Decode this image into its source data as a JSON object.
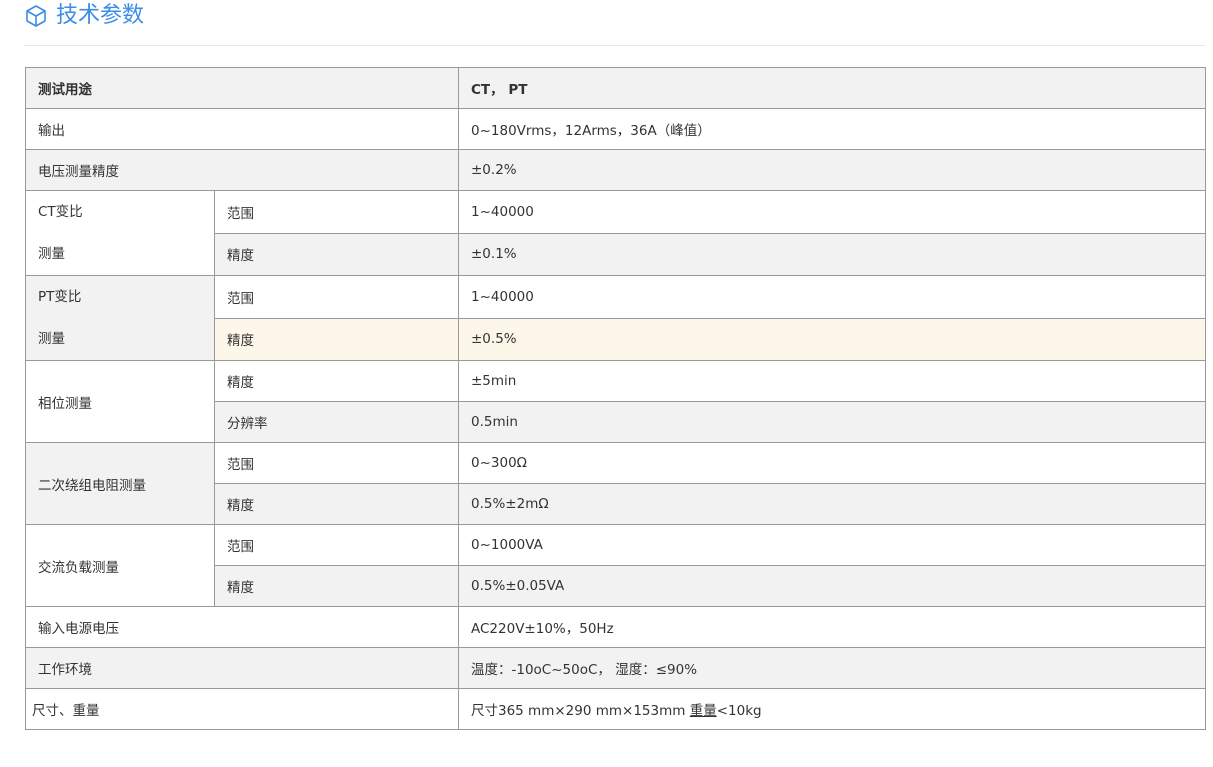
{
  "header": {
    "title": "技术参数",
    "icon": "cube-icon",
    "accent": "#3b8ee6"
  },
  "table": {
    "header": {
      "label": "测试用途",
      "value": "CT， PT"
    },
    "output": {
      "label": "输出",
      "value": "0~180Vrms，12Arms，36A（峰值）"
    },
    "voltage_accuracy": {
      "label": "电压测量精度",
      "value": "±0.2%"
    },
    "ct_ratio": {
      "label_line1": "CT变比",
      "label_line2": "测量",
      "range_label": "范围",
      "range_value": "1~40000",
      "accuracy_label": "精度",
      "accuracy_value": "±0.1%"
    },
    "pt_ratio": {
      "label_line1": "PT变比",
      "label_line2": "测量",
      "range_label": "范围",
      "range_value": "1~40000",
      "accuracy_label": "精度",
      "accuracy_value": "±0.5%"
    },
    "phase": {
      "label": "相位测量",
      "accuracy_label": "精度",
      "accuracy_value": "±5min",
      "resolution_label": "分辨率",
      "resolution_value": "0.5min"
    },
    "winding_resistance": {
      "label": "二次绕组电阻测量",
      "range_label": "范围",
      "range_value": "0~300Ω",
      "accuracy_label": "精度",
      "accuracy_value": "0.5%±2mΩ"
    },
    "ac_load": {
      "label": "交流负载测量",
      "range_label": "范围",
      "range_value": "0~1000VA",
      "accuracy_label": "精度",
      "accuracy_value": "0.5%±0.05VA"
    },
    "input_voltage": {
      "label": "输入电源电压",
      "value": "AC220V±10%，50Hz"
    },
    "environment": {
      "label": "工作环境",
      "value": "温度：-10oC~50oC， 湿度：≤90%"
    },
    "size_weight": {
      "label": "尺寸、重量",
      "value_prefix": "尺寸365 mm×290 mm×153mm ",
      "value_weight_label": "重量",
      "value_suffix": "<10kg"
    }
  }
}
